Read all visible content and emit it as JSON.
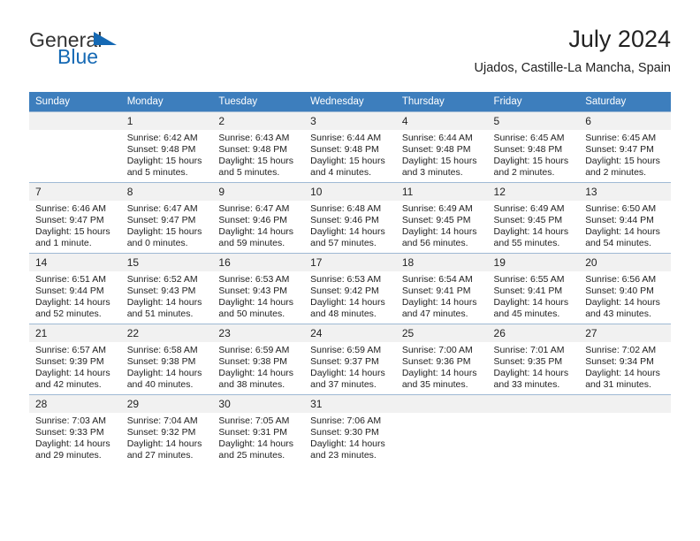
{
  "brand": {
    "name_top": "General",
    "name_bottom": "Blue",
    "triangle_color": "#1569b4",
    "text_color": "#333333"
  },
  "header": {
    "title": "July 2024",
    "subtitle": "Ujados, Castille-La Mancha, Spain"
  },
  "theme": {
    "header_row_bg": "#3d7ebd",
    "header_row_text": "#ffffff",
    "daynum_bg": "#f1f1f1",
    "grid_line": "#9fb9d4"
  },
  "weekdays": [
    "Sunday",
    "Monday",
    "Tuesday",
    "Wednesday",
    "Thursday",
    "Friday",
    "Saturday"
  ],
  "weeks": [
    [
      {
        "day": "",
        "blank": true,
        "sunrise": "",
        "sunset": "",
        "daylight_line1": "",
        "daylight_line2": ""
      },
      {
        "day": "1",
        "sunrise": "Sunrise: 6:42 AM",
        "sunset": "Sunset: 9:48 PM",
        "daylight_line1": "Daylight: 15 hours",
        "daylight_line2": "and 5 minutes."
      },
      {
        "day": "2",
        "sunrise": "Sunrise: 6:43 AM",
        "sunset": "Sunset: 9:48 PM",
        "daylight_line1": "Daylight: 15 hours",
        "daylight_line2": "and 5 minutes."
      },
      {
        "day": "3",
        "sunrise": "Sunrise: 6:44 AM",
        "sunset": "Sunset: 9:48 PM",
        "daylight_line1": "Daylight: 15 hours",
        "daylight_line2": "and 4 minutes."
      },
      {
        "day": "4",
        "sunrise": "Sunrise: 6:44 AM",
        "sunset": "Sunset: 9:48 PM",
        "daylight_line1": "Daylight: 15 hours",
        "daylight_line2": "and 3 minutes."
      },
      {
        "day": "5",
        "sunrise": "Sunrise: 6:45 AM",
        "sunset": "Sunset: 9:48 PM",
        "daylight_line1": "Daylight: 15 hours",
        "daylight_line2": "and 2 minutes."
      },
      {
        "day": "6",
        "sunrise": "Sunrise: 6:45 AM",
        "sunset": "Sunset: 9:47 PM",
        "daylight_line1": "Daylight: 15 hours",
        "daylight_line2": "and 2 minutes."
      }
    ],
    [
      {
        "day": "7",
        "sunrise": "Sunrise: 6:46 AM",
        "sunset": "Sunset: 9:47 PM",
        "daylight_line1": "Daylight: 15 hours",
        "daylight_line2": "and 1 minute."
      },
      {
        "day": "8",
        "sunrise": "Sunrise: 6:47 AM",
        "sunset": "Sunset: 9:47 PM",
        "daylight_line1": "Daylight: 15 hours",
        "daylight_line2": "and 0 minutes."
      },
      {
        "day": "9",
        "sunrise": "Sunrise: 6:47 AM",
        "sunset": "Sunset: 9:46 PM",
        "daylight_line1": "Daylight: 14 hours",
        "daylight_line2": "and 59 minutes."
      },
      {
        "day": "10",
        "sunrise": "Sunrise: 6:48 AM",
        "sunset": "Sunset: 9:46 PM",
        "daylight_line1": "Daylight: 14 hours",
        "daylight_line2": "and 57 minutes."
      },
      {
        "day": "11",
        "sunrise": "Sunrise: 6:49 AM",
        "sunset": "Sunset: 9:45 PM",
        "daylight_line1": "Daylight: 14 hours",
        "daylight_line2": "and 56 minutes."
      },
      {
        "day": "12",
        "sunrise": "Sunrise: 6:49 AM",
        "sunset": "Sunset: 9:45 PM",
        "daylight_line1": "Daylight: 14 hours",
        "daylight_line2": "and 55 minutes."
      },
      {
        "day": "13",
        "sunrise": "Sunrise: 6:50 AM",
        "sunset": "Sunset: 9:44 PM",
        "daylight_line1": "Daylight: 14 hours",
        "daylight_line2": "and 54 minutes."
      }
    ],
    [
      {
        "day": "14",
        "sunrise": "Sunrise: 6:51 AM",
        "sunset": "Sunset: 9:44 PM",
        "daylight_line1": "Daylight: 14 hours",
        "daylight_line2": "and 52 minutes."
      },
      {
        "day": "15",
        "sunrise": "Sunrise: 6:52 AM",
        "sunset": "Sunset: 9:43 PM",
        "daylight_line1": "Daylight: 14 hours",
        "daylight_line2": "and 51 minutes."
      },
      {
        "day": "16",
        "sunrise": "Sunrise: 6:53 AM",
        "sunset": "Sunset: 9:43 PM",
        "daylight_line1": "Daylight: 14 hours",
        "daylight_line2": "and 50 minutes."
      },
      {
        "day": "17",
        "sunrise": "Sunrise: 6:53 AM",
        "sunset": "Sunset: 9:42 PM",
        "daylight_line1": "Daylight: 14 hours",
        "daylight_line2": "and 48 minutes."
      },
      {
        "day": "18",
        "sunrise": "Sunrise: 6:54 AM",
        "sunset": "Sunset: 9:41 PM",
        "daylight_line1": "Daylight: 14 hours",
        "daylight_line2": "and 47 minutes."
      },
      {
        "day": "19",
        "sunrise": "Sunrise: 6:55 AM",
        "sunset": "Sunset: 9:41 PM",
        "daylight_line1": "Daylight: 14 hours",
        "daylight_line2": "and 45 minutes."
      },
      {
        "day": "20",
        "sunrise": "Sunrise: 6:56 AM",
        "sunset": "Sunset: 9:40 PM",
        "daylight_line1": "Daylight: 14 hours",
        "daylight_line2": "and 43 minutes."
      }
    ],
    [
      {
        "day": "21",
        "sunrise": "Sunrise: 6:57 AM",
        "sunset": "Sunset: 9:39 PM",
        "daylight_line1": "Daylight: 14 hours",
        "daylight_line2": "and 42 minutes."
      },
      {
        "day": "22",
        "sunrise": "Sunrise: 6:58 AM",
        "sunset": "Sunset: 9:38 PM",
        "daylight_line1": "Daylight: 14 hours",
        "daylight_line2": "and 40 minutes."
      },
      {
        "day": "23",
        "sunrise": "Sunrise: 6:59 AM",
        "sunset": "Sunset: 9:38 PM",
        "daylight_line1": "Daylight: 14 hours",
        "daylight_line2": "and 38 minutes."
      },
      {
        "day": "24",
        "sunrise": "Sunrise: 6:59 AM",
        "sunset": "Sunset: 9:37 PM",
        "daylight_line1": "Daylight: 14 hours",
        "daylight_line2": "and 37 minutes."
      },
      {
        "day": "25",
        "sunrise": "Sunrise: 7:00 AM",
        "sunset": "Sunset: 9:36 PM",
        "daylight_line1": "Daylight: 14 hours",
        "daylight_line2": "and 35 minutes."
      },
      {
        "day": "26",
        "sunrise": "Sunrise: 7:01 AM",
        "sunset": "Sunset: 9:35 PM",
        "daylight_line1": "Daylight: 14 hours",
        "daylight_line2": "and 33 minutes."
      },
      {
        "day": "27",
        "sunrise": "Sunrise: 7:02 AM",
        "sunset": "Sunset: 9:34 PM",
        "daylight_line1": "Daylight: 14 hours",
        "daylight_line2": "and 31 minutes."
      }
    ],
    [
      {
        "day": "28",
        "sunrise": "Sunrise: 7:03 AM",
        "sunset": "Sunset: 9:33 PM",
        "daylight_line1": "Daylight: 14 hours",
        "daylight_line2": "and 29 minutes."
      },
      {
        "day": "29",
        "sunrise": "Sunrise: 7:04 AM",
        "sunset": "Sunset: 9:32 PM",
        "daylight_line1": "Daylight: 14 hours",
        "daylight_line2": "and 27 minutes."
      },
      {
        "day": "30",
        "sunrise": "Sunrise: 7:05 AM",
        "sunset": "Sunset: 9:31 PM",
        "daylight_line1": "Daylight: 14 hours",
        "daylight_line2": "and 25 minutes."
      },
      {
        "day": "31",
        "sunrise": "Sunrise: 7:06 AM",
        "sunset": "Sunset: 9:30 PM",
        "daylight_line1": "Daylight: 14 hours",
        "daylight_line2": "and 23 minutes."
      },
      {
        "day": "",
        "blank": true,
        "sunrise": "",
        "sunset": "",
        "daylight_line1": "",
        "daylight_line2": ""
      },
      {
        "day": "",
        "blank": true,
        "sunrise": "",
        "sunset": "",
        "daylight_line1": "",
        "daylight_line2": ""
      },
      {
        "day": "",
        "blank": true,
        "sunrise": "",
        "sunset": "",
        "daylight_line1": "",
        "daylight_line2": ""
      }
    ]
  ]
}
